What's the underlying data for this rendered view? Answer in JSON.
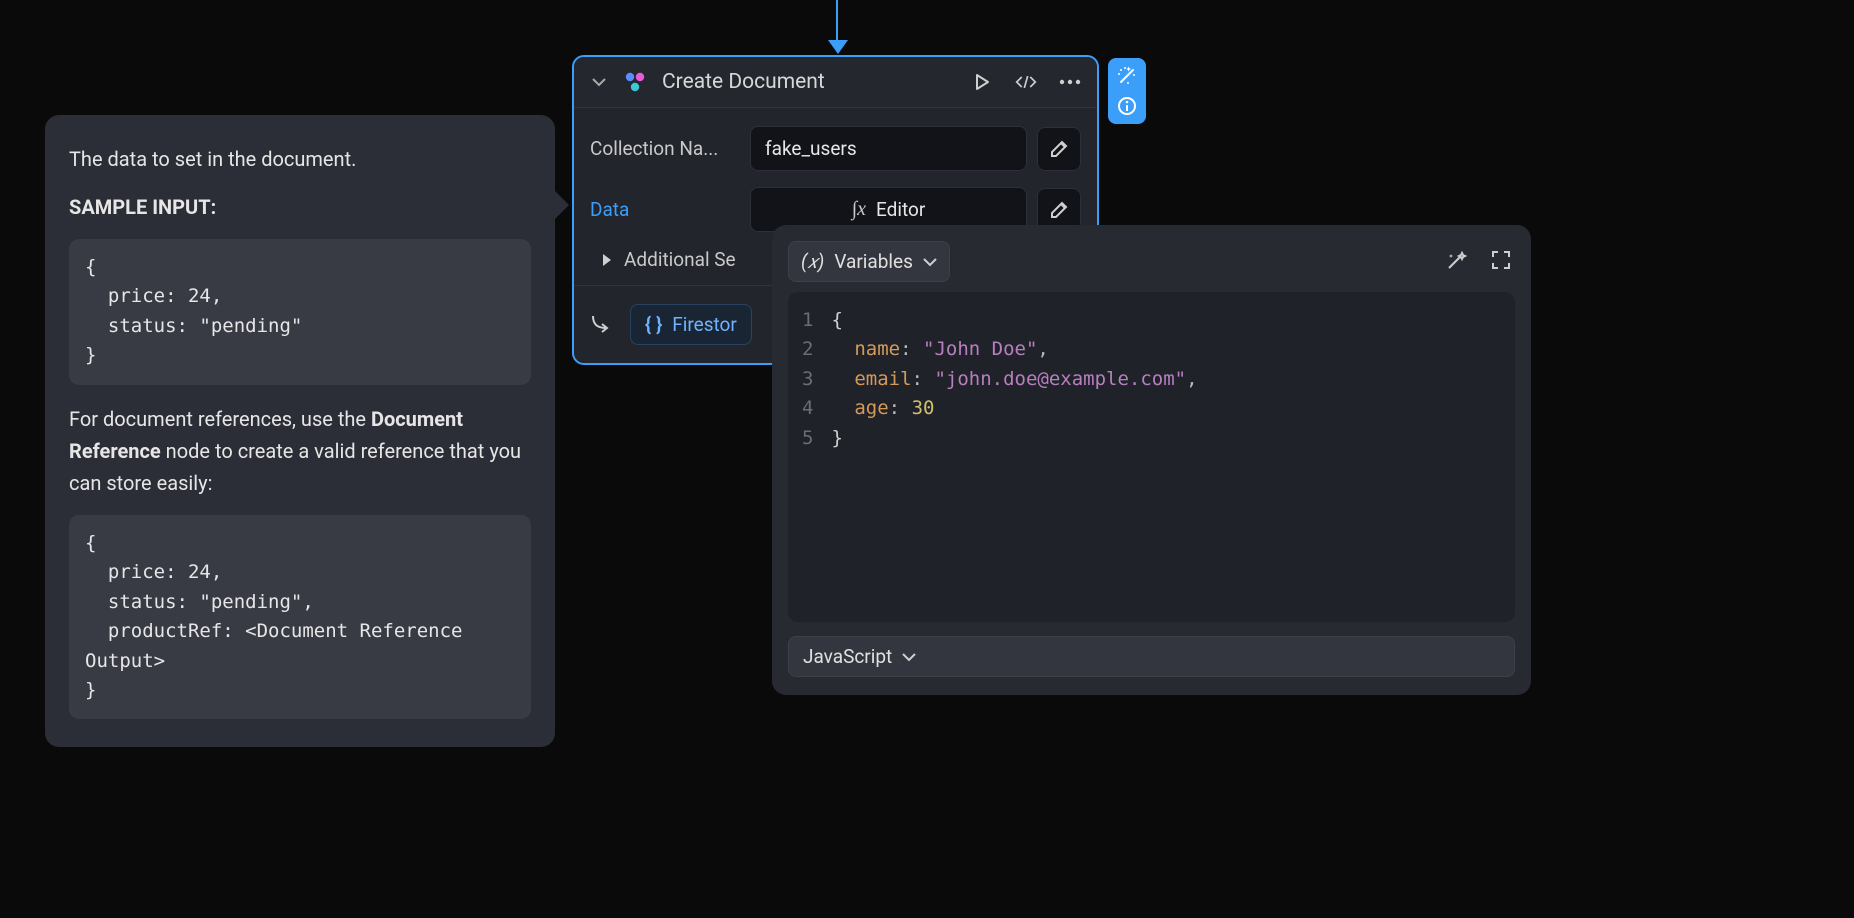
{
  "tooltip": {
    "intro": "The data to set in the document.",
    "sample_heading": "SAMPLE INPUT:",
    "sample_code": "{\n  price: 24,\n  status: \"pending\"\n}",
    "ref_text_1": "For document references, use the ",
    "ref_bold": "Document Reference",
    "ref_text_2": " node to create a valid reference that you can store easily:",
    "ref_code": "{\n  price: 24,\n  status: \"pending\",\n  productRef: <Document Reference Output>\n}"
  },
  "node": {
    "title": "Create Document",
    "fields": {
      "collection_label": "Collection Na...",
      "collection_value": "fake_users",
      "data_label": "Data",
      "data_value": "Editor",
      "additional_label": "Additional Se"
    },
    "footer_pill": "Firestor"
  },
  "editor": {
    "variables_label": "Variables",
    "language": "JavaScript",
    "code_lines": [
      {
        "n": 1,
        "indent": 0,
        "parts": [
          {
            "t": "brace",
            "v": "{"
          }
        ]
      },
      {
        "n": 2,
        "indent": 1,
        "parts": [
          {
            "t": "key",
            "v": "name"
          },
          {
            "t": "colon",
            "v": ": "
          },
          {
            "t": "str",
            "v": "\"John Doe\""
          },
          {
            "t": "comma",
            "v": ","
          }
        ]
      },
      {
        "n": 3,
        "indent": 1,
        "parts": [
          {
            "t": "key",
            "v": "email"
          },
          {
            "t": "colon",
            "v": ": "
          },
          {
            "t": "str",
            "v": "\"john.doe@example.com\""
          },
          {
            "t": "comma",
            "v": ","
          }
        ]
      },
      {
        "n": 4,
        "indent": 1,
        "parts": [
          {
            "t": "key",
            "v": "age"
          },
          {
            "t": "colon",
            "v": ": "
          },
          {
            "t": "num",
            "v": "30"
          }
        ]
      },
      {
        "n": 5,
        "indent": 0,
        "parts": [
          {
            "t": "brace",
            "v": "}"
          }
        ]
      }
    ]
  }
}
